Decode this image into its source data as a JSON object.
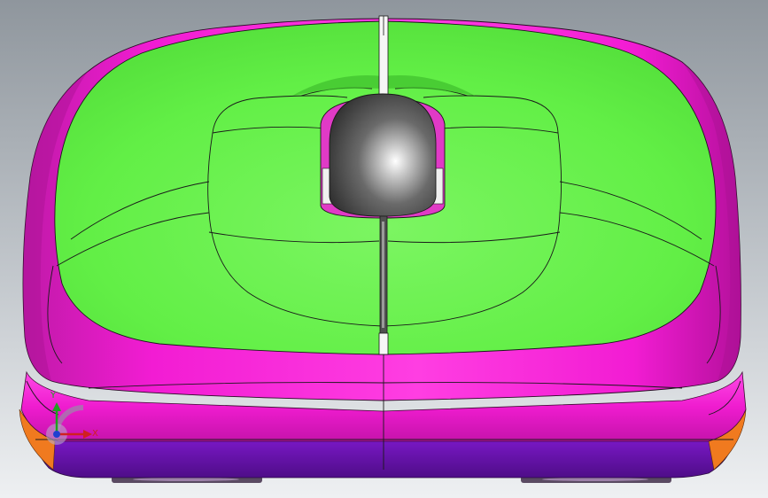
{
  "viewport": {
    "background": [
      "#8f969d",
      "#c2c7cc",
      "#eef0f2"
    ],
    "colors": {
      "top_face": "#62ef46",
      "shell": "#f21cd3",
      "shell_dark": "#b5109c",
      "base": "#6412a8",
      "orange_trim": "#f07a1f",
      "wheel": "#5c5c5c",
      "edge_lines": "#1a1a1a",
      "foot_pads": "#5a4a62"
    },
    "model_name": "mouse-shell-front-view",
    "view_orientation": "front"
  },
  "triad": {
    "x_label": "X",
    "y_label": "Y",
    "z_label": "",
    "x_color": "#d02020",
    "y_color": "#20a020",
    "z_color": "#2040d0"
  }
}
